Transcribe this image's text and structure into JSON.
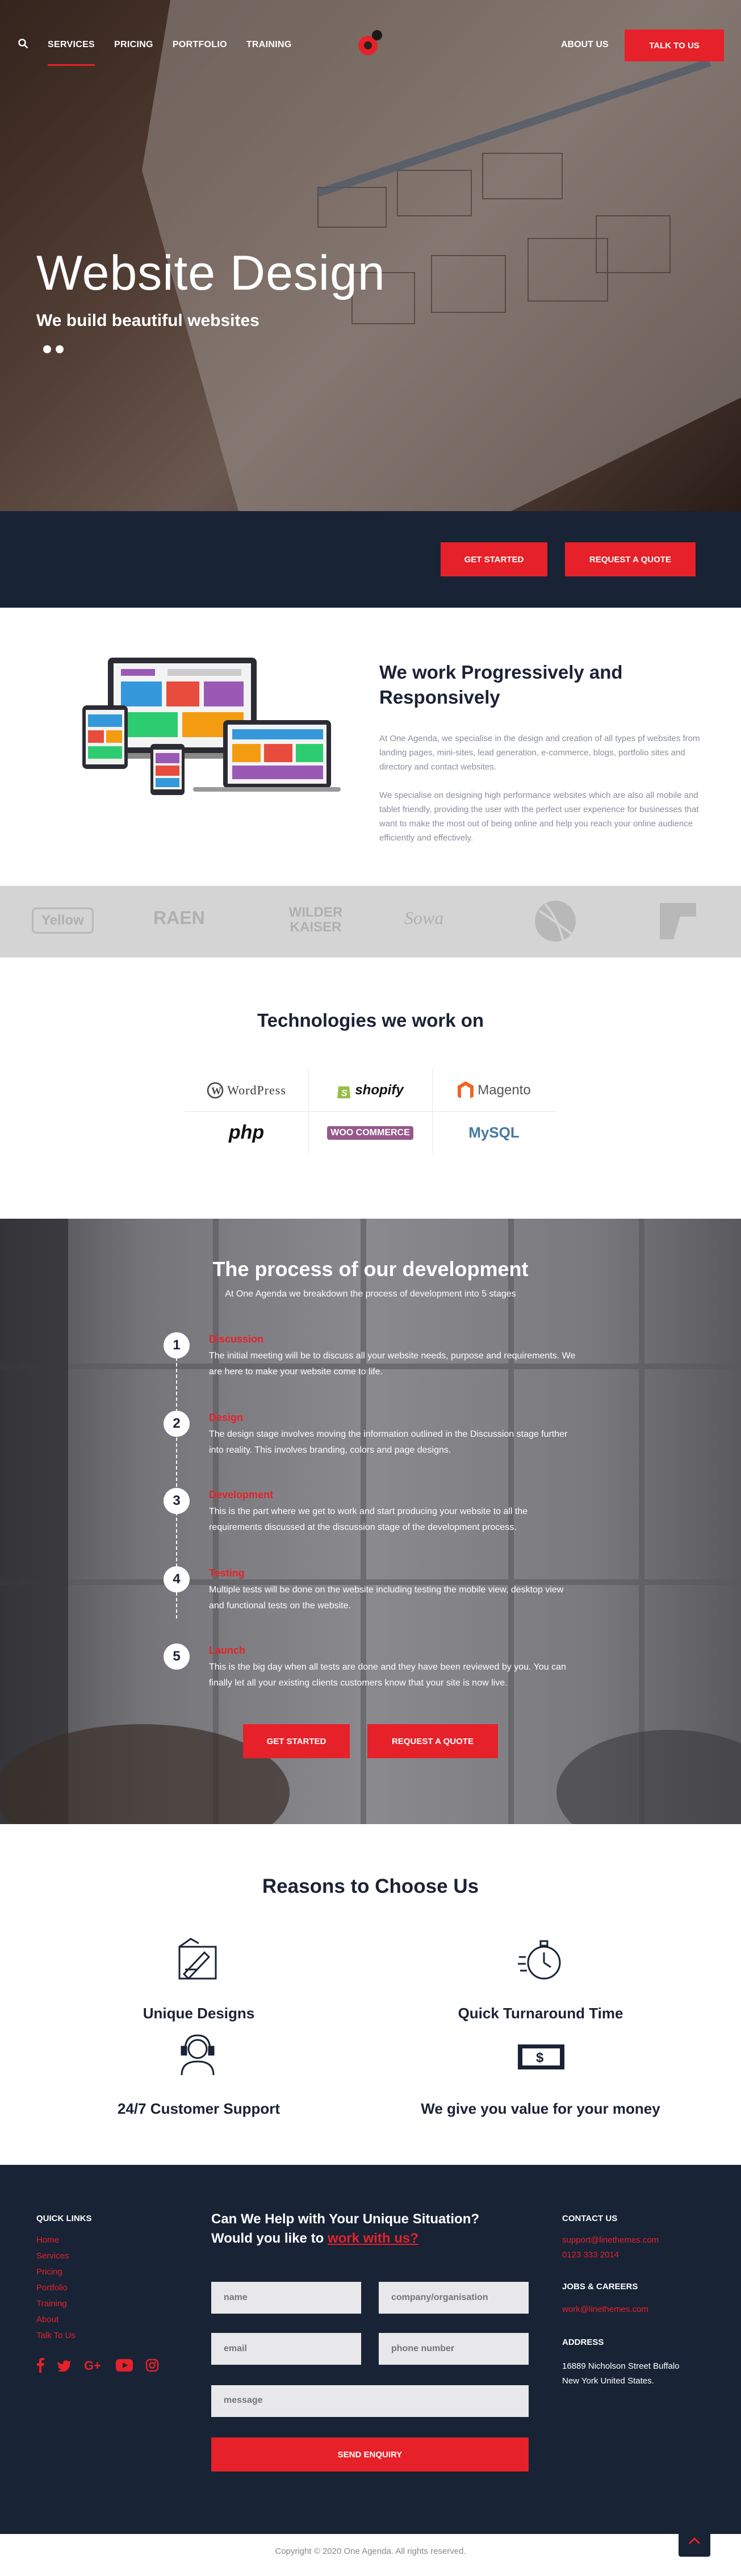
{
  "nav": {
    "links": [
      "SERVICES",
      "PRICING",
      "PORTFOLIO",
      "TRAINING"
    ],
    "about": "ABOUT US",
    "talk": "TALK TO US"
  },
  "hero": {
    "title": "Website Design",
    "subtitle": "We build beautiful websites"
  },
  "cta": {
    "get_started": "GET STARTED",
    "request_quote": "REQUEST A QUOTE"
  },
  "progressive": {
    "title": "We work Progressively and Responsively",
    "p1": "At One Agenda, we specialise in the design and creation of all types pf websites from landing pages, mini-sites, lead generation, e-commerce, blogs, portfolio sites and directory and contact websites.",
    "p2": "We specialise on designing high performance websites which are also all mobile and tablet friendly, providing the user with the perfect user experience for businesses that want to make the most out of being online and help you reach your online audience efficiently and effectively."
  },
  "logos": [
    "Yellow",
    "RAEN",
    "WILDER KAISER",
    "Sowa",
    "ball",
    "P7"
  ],
  "tech": {
    "title": "Technologies we work on",
    "items": [
      "WordPress",
      "shopify",
      "Magento",
      "php",
      "WOO COMMERCE",
      "MySQL"
    ]
  },
  "process": {
    "title": "The process of our development",
    "intro": "At One Agenda we breakdown the process of development into 5 stages",
    "steps": [
      {
        "n": "1",
        "title": "Discussion",
        "text": "The initial meeting will be to discuss all your website needs, purpose and requirements. We are here to make your website come to life."
      },
      {
        "n": "2",
        "title": "Design",
        "text": "The design stage involves moving the information outlined in the Discussion stage further into reality. This involves branding, colors and page designs."
      },
      {
        "n": "3",
        "title": "Development",
        "text": "This is the part where we get to work and start producing your website to all the requirements discussed at the discussion stage of the development process."
      },
      {
        "n": "4",
        "title": "Testing",
        "text": "Multiple tests will be done on the website including testing the mobile view, desktop view and functional tests on the website."
      },
      {
        "n": "5",
        "title": "Launch",
        "text": "This is the big day when all tests are done and they have been reviewed by you. You can finally let all your existing clients customers know that your site is now live."
      }
    ]
  },
  "reasons": {
    "title": "Reasons to Choose Us",
    "items": [
      "Unique Designs",
      "Quick Turnaround Time",
      "24/7 Customer Support",
      "We give you value for your money"
    ]
  },
  "footer": {
    "quick_links_title": "QUICK LINKS",
    "quick_links": [
      "Home",
      "Services",
      "Pricing",
      "Portfolio",
      "Training",
      "About",
      "Talk To Us"
    ],
    "help_title": "Can We Help with Your Unique Situation?",
    "help_sub": "Would you like to",
    "help_link": "work with us?",
    "form": {
      "name": "name",
      "company": "company/organisation",
      "email": "email",
      "phone": "phone number",
      "message": "message",
      "send": "SEND ENQUIRY"
    },
    "contact_title": "CONTACT US",
    "contact_email": "support@linethemes.com",
    "contact_phone": "0123 333 2014",
    "jobs_title": "JOBS & CAREERS",
    "jobs_email": "work@linethemes.com",
    "address_title": "ADDRESS",
    "address1": "16889 Nicholson Street Buffalo",
    "address2": "New York United States.",
    "copyright": "Copyright © 2020 One Agenda. All rights reserved."
  },
  "colors": {
    "accent": "#e62129",
    "navy": "#182336"
  }
}
